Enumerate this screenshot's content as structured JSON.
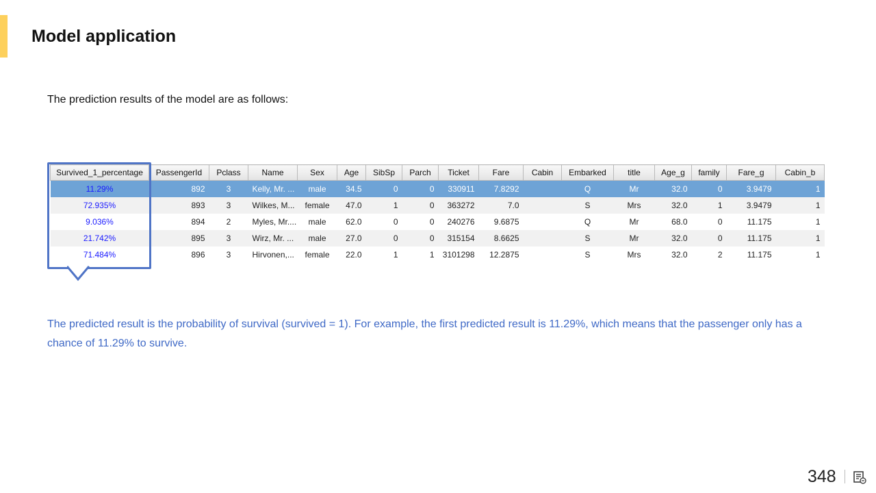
{
  "slide": {
    "title": "Model application",
    "intro": "The prediction results of the model are as follows:",
    "explanation": "The predicted result is the probability of survival (survived = 1). For example, the first predicted result is 11.29%, which means that the passenger only has a chance of 11.29% to survive.",
    "page_number": "348",
    "accent_color": "#fdd05c",
    "highlight_color": "#4f74c6",
    "explanation_color": "#3f69c6"
  },
  "table": {
    "headers": [
      "Survived_1_percentage",
      "PassengerId",
      "Pclass",
      "Name",
      "Sex",
      "Age",
      "SibSp",
      "Parch",
      "Ticket",
      "Fare",
      "Cabin",
      "Embarked",
      "title",
      "Age_g",
      "family",
      "Fare_g",
      "Cabin_b"
    ],
    "rows": [
      [
        "11.29%",
        "892",
        "3",
        "Kelly, Mr. ...",
        "male",
        "34.5",
        "0",
        "0",
        "330911",
        "7.8292",
        "",
        "Q",
        "Mr",
        "32.0",
        "0",
        "3.9479",
        "1"
      ],
      [
        "72.935%",
        "893",
        "3",
        "Wilkes, M...",
        "female",
        "47.0",
        "1",
        "0",
        "363272",
        "7.0",
        "",
        "S",
        "Mrs",
        "32.0",
        "1",
        "3.9479",
        "1"
      ],
      [
        "9.036%",
        "894",
        "2",
        "Myles, Mr....",
        "male",
        "62.0",
        "0",
        "0",
        "240276",
        "9.6875",
        "",
        "Q",
        "Mr",
        "68.0",
        "0",
        "11.175",
        "1"
      ],
      [
        "21.742%",
        "895",
        "3",
        "Wirz, Mr. ...",
        "male",
        "27.0",
        "0",
        "0",
        "315154",
        "8.6625",
        "",
        "S",
        "Mr",
        "32.0",
        "0",
        "11.175",
        "1"
      ],
      [
        "71.484%",
        "896",
        "3",
        "Hirvonen,...",
        "female",
        "22.0",
        "1",
        "1",
        "3101298",
        "12.2875",
        "",
        "S",
        "Mrs",
        "32.0",
        "2",
        "11.175",
        "1"
      ]
    ],
    "selected_row": 0,
    "selected_row_color": "#6ea3d6",
    "percentage_text_color": "#1a1aff"
  },
  "icons": {
    "notes": "notes-icon"
  }
}
